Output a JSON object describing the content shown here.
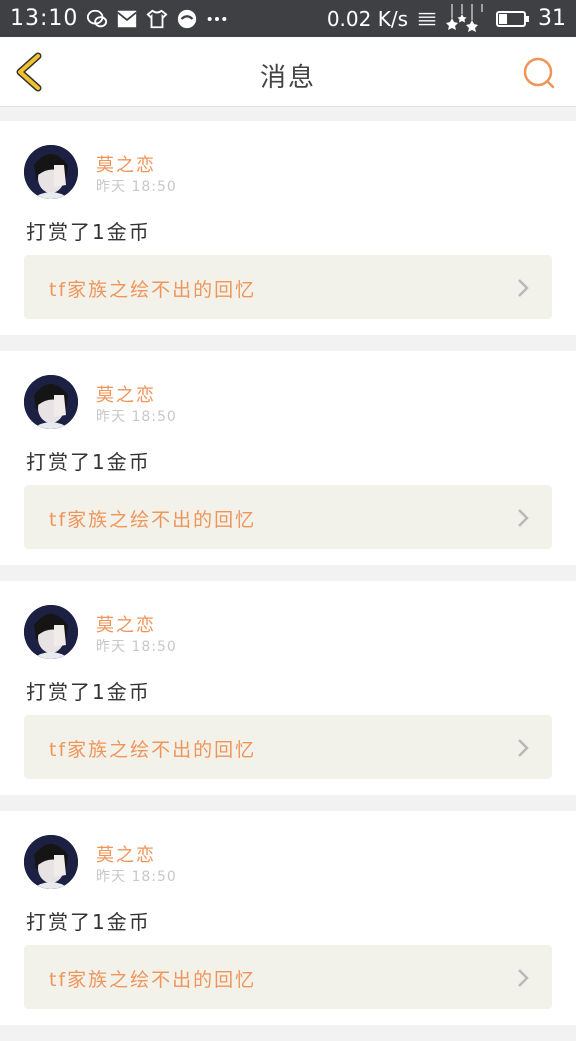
{
  "status_bar": {
    "time": "13:10",
    "net_speed": "0.02 K/s",
    "battery": "31",
    "icons": [
      "wechat-icon",
      "mail-icon",
      "tshirt-icon",
      "face-icon",
      "more-dots-icon",
      "menu-lines-icon",
      "stars-icon",
      "battery-icon"
    ]
  },
  "nav": {
    "title": "消息",
    "back_icon": "back-chevron-icon",
    "search_icon": "search-icon"
  },
  "colors": {
    "accent": "#f0955a",
    "back_yellow": "#f2c12e",
    "ref_bg": "#f3f2ea",
    "status_bg": "#3f4044"
  },
  "messages": [
    {
      "author": "莫之恋",
      "time": "昨天 18:50",
      "text": "打赏了1金币",
      "ref": "tf家族之绘不出的回忆"
    },
    {
      "author": "莫之恋",
      "time": "昨天 18:50",
      "text": "打赏了1金币",
      "ref": "tf家族之绘不出的回忆"
    },
    {
      "author": "莫之恋",
      "time": "昨天 18:50",
      "text": "打赏了1金币",
      "ref": "tf家族之绘不出的回忆"
    },
    {
      "author": "莫之恋",
      "time": "昨天 18:50",
      "text": "打赏了1金币",
      "ref": "tf家族之绘不出的回忆"
    }
  ]
}
